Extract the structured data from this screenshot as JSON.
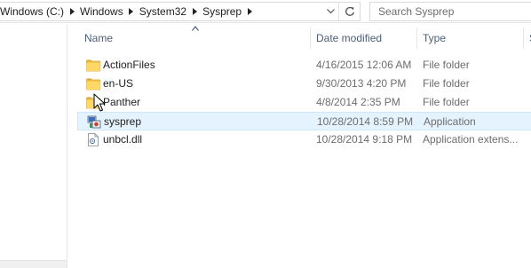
{
  "address": {
    "crumbs": [
      "Windows (C:)",
      "Windows",
      "System32",
      "Sysprep"
    ]
  },
  "search": {
    "placeholder": "Search Sysprep"
  },
  "columns": {
    "name": "Name",
    "date": "Date modified",
    "type": "Type",
    "size": "S"
  },
  "files": [
    {
      "name": "ActionFiles",
      "date": "4/16/2015 12:06 AM",
      "type": "File folder",
      "icon": "folder-icon"
    },
    {
      "name": "en-US",
      "date": "9/30/2013 4:20 PM",
      "type": "File folder",
      "icon": "folder-icon"
    },
    {
      "name": "Panther",
      "date": "4/8/2014 2:35 PM",
      "type": "File folder",
      "icon": "folder-icon"
    },
    {
      "name": "sysprep",
      "date": "10/28/2014 8:59 PM",
      "type": "Application",
      "icon": "application-icon"
    },
    {
      "name": "unbcl.dll",
      "date": "10/28/2014 9:18 PM",
      "type": "Application extens...",
      "icon": "dll-file-icon"
    }
  ],
  "colors": {
    "header_text": "#4c607a",
    "hover_bg": "#e5f3ff",
    "hover_border": "#cce8ff",
    "folder": "#e8b84a"
  }
}
